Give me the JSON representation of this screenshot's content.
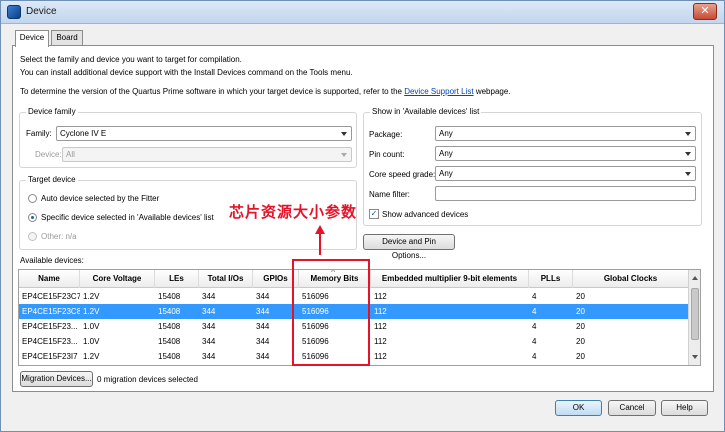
{
  "window": {
    "title": "Device",
    "close_glyph": "✕"
  },
  "tabs": [
    {
      "label": "Device"
    },
    {
      "label": "Board"
    }
  ],
  "intro": {
    "line1": "Select the family and device you want to target for compilation.",
    "line2": "You can install additional device support with the Install Devices command on the Tools menu.",
    "line3_pre": "To determine the version of the Quartus Prime software in which your target device is supported, refer to the",
    "line3_link": "Device Support List",
    "line3_post": "webpage."
  },
  "device_family": {
    "group_title": "Device family",
    "family_label": "Family:",
    "family_value": "Cyclone IV E",
    "device_label": "Device:",
    "device_value": "All"
  },
  "target_device": {
    "group_title": "Target device",
    "options": [
      {
        "label": "Auto device selected by the Fitter"
      },
      {
        "label": "Specific device selected in 'Available devices' list"
      },
      {
        "label": "Other:  n/a"
      }
    ]
  },
  "filters": {
    "group_title": "Show in 'Available devices' list",
    "package_label": "Package:",
    "package_value": "Any",
    "pin_count_label": "Pin count:",
    "pin_count_value": "Any",
    "speed_label": "Core speed grade:",
    "speed_value": "Any",
    "name_filter_label": "Name filter:",
    "name_filter_value": "",
    "advanced_label": "Show advanced devices",
    "check_glyph": "✓"
  },
  "device_pin_button": "Device and Pin Options...",
  "annotation": "芯片资源大小参数",
  "available_devices": {
    "label": "Available devices:",
    "columns": [
      "Name",
      "Core Voltage",
      "LEs",
      "Total I/Os",
      "GPIOs",
      "Memory Bits",
      "Embedded multiplier 9-bit elements",
      "PLLs",
      "Global Clocks"
    ],
    "sort_indicator": "^",
    "rows": [
      [
        "EP4CE15F23C7",
        "1.2V",
        "15408",
        "344",
        "344",
        "516096",
        "112",
        "4",
        "20"
      ],
      [
        "EP4CE15F23C8",
        "1.2V",
        "15408",
        "344",
        "344",
        "516096",
        "112",
        "4",
        "20"
      ],
      [
        "EP4CE15F23...",
        "1.0V",
        "15408",
        "344",
        "344",
        "516096",
        "112",
        "4",
        "20"
      ],
      [
        "EP4CE15F23...",
        "1.0V",
        "15408",
        "344",
        "344",
        "516096",
        "112",
        "4",
        "20"
      ],
      [
        "EP4CE15F23I7",
        "1.2V",
        "15408",
        "344",
        "344",
        "516096",
        "112",
        "4",
        "20"
      ]
    ],
    "selected_row": 1
  },
  "migration": {
    "button": "Migration Devices...",
    "status": "0 migration devices selected"
  },
  "footer": {
    "ok": "OK",
    "cancel": "Cancel",
    "help": "Help"
  }
}
